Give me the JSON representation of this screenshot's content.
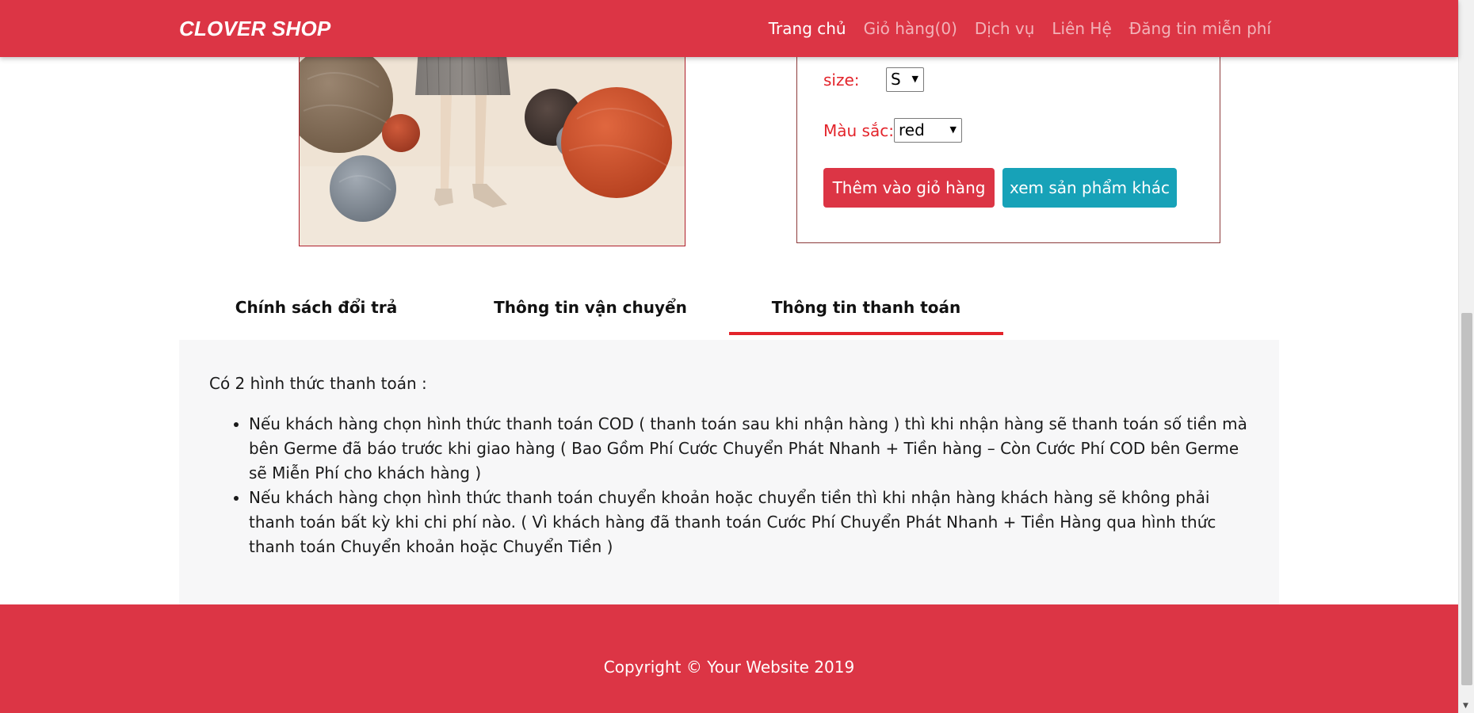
{
  "navbar": {
    "brand": "CLOVER SHOP",
    "links": [
      {
        "label": "Trang chủ",
        "active": true
      },
      {
        "label": "Giỏ hàng(0)",
        "active": false
      },
      {
        "label": "Dịch vụ",
        "active": false
      },
      {
        "label": "Liên Hệ",
        "active": false
      },
      {
        "label": "Đăng tin miễn phí",
        "active": false
      }
    ]
  },
  "product": {
    "size_label": "size:",
    "size_value": "S",
    "color_label": "Màu sắc:",
    "color_value": "red",
    "add_to_cart_label": "Thêm vào giỏ hàng",
    "view_other_label": "xem sản phẩm khác"
  },
  "tabs": [
    {
      "label": "Chính sách đổi trả",
      "active": false
    },
    {
      "label": "Thông tin vận chuyển",
      "active": false
    },
    {
      "label": "Thông tin thanh toán",
      "active": true
    }
  ],
  "payment_info": {
    "intro": "Có 2 hình thức thanh toán :",
    "items": [
      "Nếu khách hàng chọn hình thức thanh toán COD ( thanh toán sau khi nhận hàng ) thì khi nhận hàng sẽ thanh toán số tiền mà bên Germe đã báo trước khi giao hàng ( Bao Gồm Phí Cước Chuyển Phát Nhanh + Tiền hàng – Còn Cước Phí COD bên Germe sẽ Miễn Phí cho khách hàng )",
      "Nếu khách hàng chọn hình thức thanh toán chuyển khoản hoặc chuyển tiền thì khi nhận hàng khách hàng sẽ không phải thanh toán bất kỳ khi chi phí nào. ( Vì khách hàng đã thanh toán Cước Phí Chuyển Phát Nhanh + Tiền Hàng qua hình thức thanh toán Chuyển khoản hoặc Chuyển Tiền )"
    ]
  },
  "footer": {
    "copyright": "Copyright © Your Website 2019"
  },
  "colors": {
    "primary_red": "#dc3545",
    "teal": "#17a2b8",
    "label_red": "#e3242b",
    "content_bg": "#f7f7f8"
  }
}
